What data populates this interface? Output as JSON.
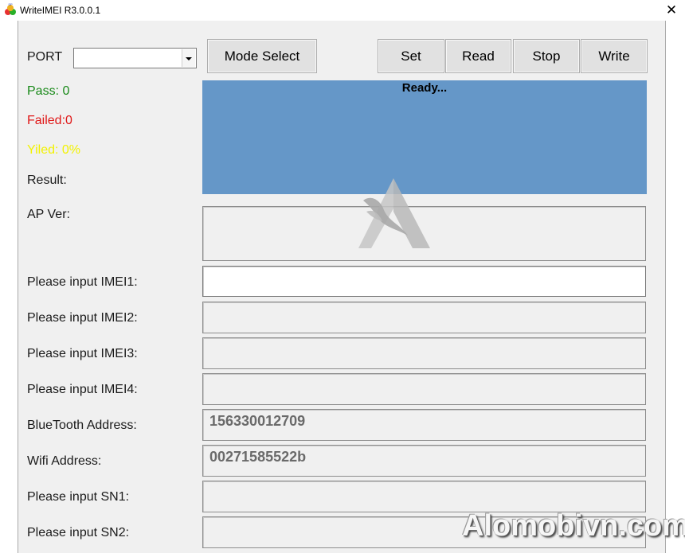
{
  "window": {
    "title": "WriteIMEI R3.0.0.1",
    "close_glyph": "✕"
  },
  "toolbar": {
    "port_label": "PORT",
    "port_value": "",
    "mode_select": "Mode Select",
    "set": "Set",
    "read": "Read",
    "stop": "Stop",
    "write": "Write"
  },
  "stats": {
    "pass": "Pass:  0",
    "failed": "Failed:0",
    "yield": "Yiled: 0%",
    "result": "Result:",
    "colors": {
      "pass": "#1a8a1a",
      "failed": "#e01818",
      "yield": "#f2f200"
    }
  },
  "status": {
    "text": "Ready...",
    "color": "#6597c8"
  },
  "form": {
    "ap_ver_label": "AP Ver:",
    "ap_ver_value": "",
    "imei1_label": "Please input IMEI1:",
    "imei1_value": "",
    "imei2_label": "Please input IMEI2:",
    "imei2_value": "",
    "imei3_label": "Please input IMEI3:",
    "imei3_value": "",
    "imei4_label": "Please input IMEI4:",
    "imei4_value": "",
    "bt_label": "BlueTooth Address:",
    "bt_value": "156330012709",
    "wifi_label": "Wifi Address:",
    "wifi_value": "00271585522b",
    "sn1_label": "Please input SN1:",
    "sn1_value": "",
    "sn2_label": "Please input SN2:",
    "sn2_value": ""
  },
  "watermark": {
    "text": "Alomobivn.com",
    "logo_icon": "eagle-a-logo-icon"
  }
}
